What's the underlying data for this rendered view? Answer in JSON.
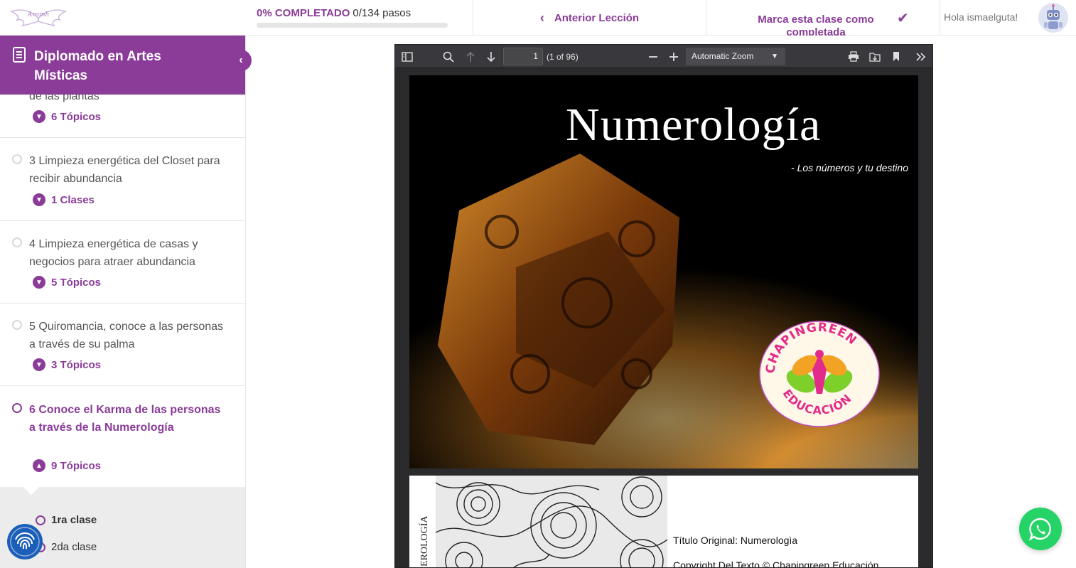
{
  "header": {
    "logo": "Aromh",
    "progress": {
      "percent_label": "0% COMPLETADO",
      "steps_label": "0/134 pasos",
      "fraction": 0
    },
    "prev_lesson_label": "Anterior Lección",
    "mark_complete_label": "Marca esta clase como completada",
    "greeting": "Hola ismaelguta!"
  },
  "sidebar": {
    "course_title": "Diplomado en Artes Místicas",
    "sections": [
      {
        "title": "de las plantas",
        "count": "6 Tópicos",
        "state": "expand"
      },
      {
        "title": "3 Limpieza energética del Closet para recibir abundancia",
        "count": "1 Clases",
        "state": "expand"
      },
      {
        "title": "4 Limpieza energética de casas y negocios para atraer abundancia",
        "count": "5 Tópicos",
        "state": "expand"
      },
      {
        "title": "5 Quiromancia, conoce a las personas a través de su palma",
        "count": "3 Tópicos",
        "state": "expand"
      },
      {
        "title": "6 Conoce el Karma de las personas a través de la Numerología",
        "count": "9 Tópicos",
        "state": "collapse"
      }
    ],
    "topics": [
      {
        "label": "1ra clase"
      },
      {
        "label": "2da clase"
      }
    ]
  },
  "pdf_viewer": {
    "page_number": "1",
    "page_count": "(1 of 96)",
    "zoom": "Automatic Zoom",
    "page1": {
      "title": "Numerología",
      "subtitle": "- Los números y tu destino",
      "logo_top": "CHAPINGREEN",
      "logo_bottom": "EDUCACIÓN"
    },
    "page2": {
      "side_text": "EROLOGÍA",
      "line1": "Título Original: Numerologìa",
      "line2": "Copyright Del Texto © Chapingreen Educación"
    }
  },
  "colors": {
    "brand_purple": "#8a3c98",
    "viewer_dark": "#38383d",
    "whatsapp_green": "#25d366",
    "fingerprint_blue": "#1c5fb8"
  }
}
